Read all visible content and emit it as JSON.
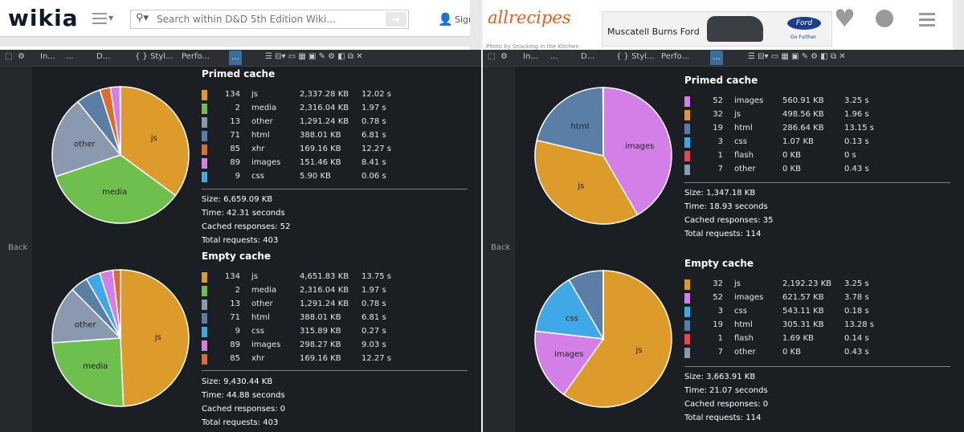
{
  "left": {
    "site": {
      "logo": "wikia",
      "search_placeholder": "Search within D&D 5th Edition Wiki...",
      "user_label": "Sign",
      "menu_icon": "hamburger-icon",
      "search_icon": "search-icon"
    },
    "devtools": {
      "tabs": [
        "In...",
        "...",
        "D...",
        "{ } Styl...",
        "Perfo...",
        "..."
      ]
    },
    "back_label": "Back",
    "primed": {
      "title": "Primed cache",
      "rows": [
        {
          "count": "134",
          "name": "js",
          "size": "2,337.28 KB",
          "time": "12.02 s",
          "color": "#dd9b2c"
        },
        {
          "count": "2",
          "name": "media",
          "size": "2,316.04 KB",
          "time": "1.97 s",
          "color": "#6fbf4e"
        },
        {
          "count": "13",
          "name": "other",
          "size": "1,291.24 KB",
          "time": "0.78 s",
          "color": "#8a99ad"
        },
        {
          "count": "71",
          "name": "html",
          "size": "388.01 KB",
          "time": "6.81 s",
          "color": "#5b7ea6"
        },
        {
          "count": "85",
          "name": "xhr",
          "size": "169.16 KB",
          "time": "12.27 s",
          "color": "#e06a2c"
        },
        {
          "count": "89",
          "name": "images",
          "size": "151.46 KB",
          "time": "8.41 s",
          "color": "#d47fe8"
        },
        {
          "count": "9",
          "name": "css",
          "size": "5.90 KB",
          "time": "0.06 s",
          "color": "#3ea9e6"
        }
      ],
      "summary": [
        "Size: 6,659.09 KB",
        "Time: 42.31 seconds",
        "Cached responses: 52",
        "Total requests: 403"
      ]
    },
    "empty": {
      "title": "Empty cache",
      "rows": [
        {
          "count": "134",
          "name": "js",
          "size": "4,651.83 KB",
          "time": "13.75 s",
          "color": "#dd9b2c"
        },
        {
          "count": "2",
          "name": "media",
          "size": "2,316.04 KB",
          "time": "1.97 s",
          "color": "#6fbf4e"
        },
        {
          "count": "13",
          "name": "other",
          "size": "1,291.24 KB",
          "time": "0.78 s",
          "color": "#8a99ad"
        },
        {
          "count": "71",
          "name": "html",
          "size": "388.01 KB",
          "time": "6.81 s",
          "color": "#5b7ea6"
        },
        {
          "count": "9",
          "name": "css",
          "size": "315.89 KB",
          "time": "0.27 s",
          "color": "#3ea9e6"
        },
        {
          "count": "89",
          "name": "images",
          "size": "298.27 KB",
          "time": "9.03 s",
          "color": "#d47fe8"
        },
        {
          "count": "85",
          "name": "xhr",
          "size": "169.16 KB",
          "time": "12.27 s",
          "color": "#e06a2c"
        }
      ],
      "summary": [
        "Size: 9,430.44 KB",
        "Time: 44.88 seconds",
        "Cached responses: 0",
        "Total requests: 403"
      ]
    },
    "pie_primed_labels": [
      "js",
      "media",
      "other"
    ],
    "pie_empty_labels": [
      "js",
      "media",
      "other"
    ]
  },
  "right": {
    "site": {
      "logo": "allrecipes",
      "ad_text": "Muscatell Burns Ford",
      "brand": "Ford",
      "brand_tagline": "Go Further",
      "photo_credit": "Photo by Snacking in the Kitchen",
      "heart_icon": "heart-icon",
      "user_icon": "user-icon",
      "menu_icon": "hamburger-icon"
    },
    "devtools": {
      "tabs": [
        "In...",
        "...",
        "D...",
        "{ } Styl...",
        "Perfo...",
        "..."
      ]
    },
    "back_label": "Back",
    "primed": {
      "title": "Primed cache",
      "rows": [
        {
          "count": "52",
          "name": "images",
          "size": "560.91 KB",
          "time": "3.25 s",
          "color": "#d47fe8"
        },
        {
          "count": "32",
          "name": "js",
          "size": "498.56 KB",
          "time": "1.96 s",
          "color": "#dd9b2c"
        },
        {
          "count": "19",
          "name": "html",
          "size": "286.64 KB",
          "time": "13.15 s",
          "color": "#5b7ea6"
        },
        {
          "count": "3",
          "name": "css",
          "size": "1.07 KB",
          "time": "0.13 s",
          "color": "#3ea9e6"
        },
        {
          "count": "1",
          "name": "flash",
          "size": "0 KB",
          "time": "0 s",
          "color": "#e0485b"
        },
        {
          "count": "7",
          "name": "other",
          "size": "0 KB",
          "time": "0.43 s",
          "color": "#8a99ad"
        }
      ],
      "summary": [
        "Size: 1,347.18 KB",
        "Time: 18.93 seconds",
        "Cached responses: 35",
        "Total requests: 114"
      ]
    },
    "empty": {
      "title": "Empty cache",
      "rows": [
        {
          "count": "32",
          "name": "js",
          "size": "2,192.23 KB",
          "time": "3.25 s",
          "color": "#dd9b2c"
        },
        {
          "count": "52",
          "name": "images",
          "size": "621.57 KB",
          "time": "3.78 s",
          "color": "#d47fe8"
        },
        {
          "count": "3",
          "name": "css",
          "size": "543.11 KB",
          "time": "0.18 s",
          "color": "#3ea9e6"
        },
        {
          "count": "19",
          "name": "html",
          "size": "305.31 KB",
          "time": "13.28 s",
          "color": "#5b7ea6"
        },
        {
          "count": "1",
          "name": "flash",
          "size": "1.69 KB",
          "time": "0.14 s",
          "color": "#e0485b"
        },
        {
          "count": "7",
          "name": "other",
          "size": "0 KB",
          "time": "0.43 s",
          "color": "#8a99ad"
        }
      ],
      "summary": [
        "Size: 3,663.91 KB",
        "Time: 21.07 seconds",
        "Cached responses: 0",
        "Total requests: 114"
      ]
    },
    "pie_primed_labels": [
      "images",
      "js",
      "html"
    ],
    "pie_empty_labels": [
      "js",
      "images",
      "css"
    ]
  },
  "chart_data": [
    {
      "type": "pie",
      "title": "Primed cache",
      "categories": [
        "js",
        "media",
        "other",
        "html",
        "xhr",
        "images",
        "css"
      ],
      "values": [
        2337.28,
        2316.04,
        1291.24,
        388.01,
        169.16,
        151.46,
        5.9
      ]
    },
    {
      "type": "pie",
      "title": "Empty cache",
      "categories": [
        "js",
        "media",
        "other",
        "html",
        "css",
        "images",
        "xhr"
      ],
      "values": [
        4651.83,
        2316.04,
        1291.24,
        388.01,
        315.89,
        298.27,
        169.16
      ]
    },
    {
      "type": "pie",
      "title": "Primed cache",
      "categories": [
        "images",
        "js",
        "html",
        "css",
        "flash",
        "other"
      ],
      "values": [
        560.91,
        498.56,
        286.64,
        1.07,
        0,
        0
      ]
    },
    {
      "type": "pie",
      "title": "Empty cache",
      "categories": [
        "js",
        "images",
        "css",
        "html",
        "flash",
        "other"
      ],
      "values": [
        2192.23,
        621.57,
        543.11,
        305.31,
        1.69,
        0
      ]
    }
  ]
}
